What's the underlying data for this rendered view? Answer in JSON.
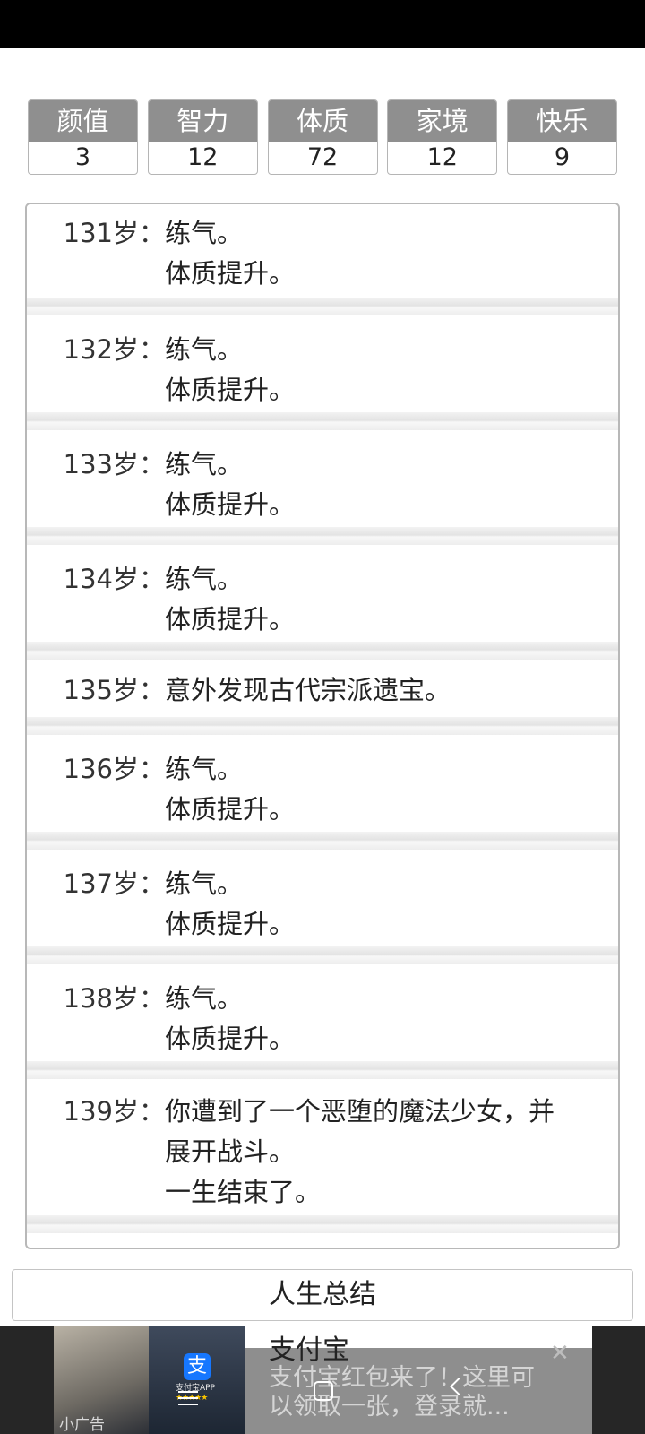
{
  "stats": [
    {
      "label": "颜值",
      "value": "3"
    },
    {
      "label": "智力",
      "value": "12"
    },
    {
      "label": "体质",
      "value": "72"
    },
    {
      "label": "家境",
      "value": "12"
    },
    {
      "label": "快乐",
      "value": "9"
    }
  ],
  "log": [
    {
      "age": "131岁：",
      "lines": [
        "练气。",
        "体质提升。"
      ]
    },
    {
      "age": "132岁：",
      "lines": [
        "练气。",
        "体质提升。"
      ]
    },
    {
      "age": "133岁：",
      "lines": [
        "练气。",
        "体质提升。"
      ]
    },
    {
      "age": "134岁：",
      "lines": [
        "练气。",
        "体质提升。"
      ]
    },
    {
      "age": "135岁：",
      "lines": [
        "意外发现古代宗派遗宝。"
      ]
    },
    {
      "age": "136岁：",
      "lines": [
        "练气。",
        "体质提升。"
      ]
    },
    {
      "age": "137岁：",
      "lines": [
        "练气。",
        "体质提升。"
      ]
    },
    {
      "age": "138岁：",
      "lines": [
        "练气。",
        "体质提升。"
      ]
    },
    {
      "age": "139岁：",
      "lines": [
        "你遭到了一个恶堕的魔法少女，并",
        "展开战斗。",
        "一生结束了。"
      ]
    }
  ],
  "summary_button": "人生总结",
  "ad": {
    "title": "支付宝",
    "description": "支付宝红包来了！这里可以领取一张，登录就...",
    "app_label": "支付宝APP",
    "stars": "★★★★★",
    "tag": "小广告",
    "logo_glyph": "支",
    "close_glyph": "✕"
  },
  "icons": {
    "ad_close": "close-icon",
    "nav_menu": "menu-icon",
    "nav_home": "home-icon",
    "nav_back": "back-icon"
  }
}
